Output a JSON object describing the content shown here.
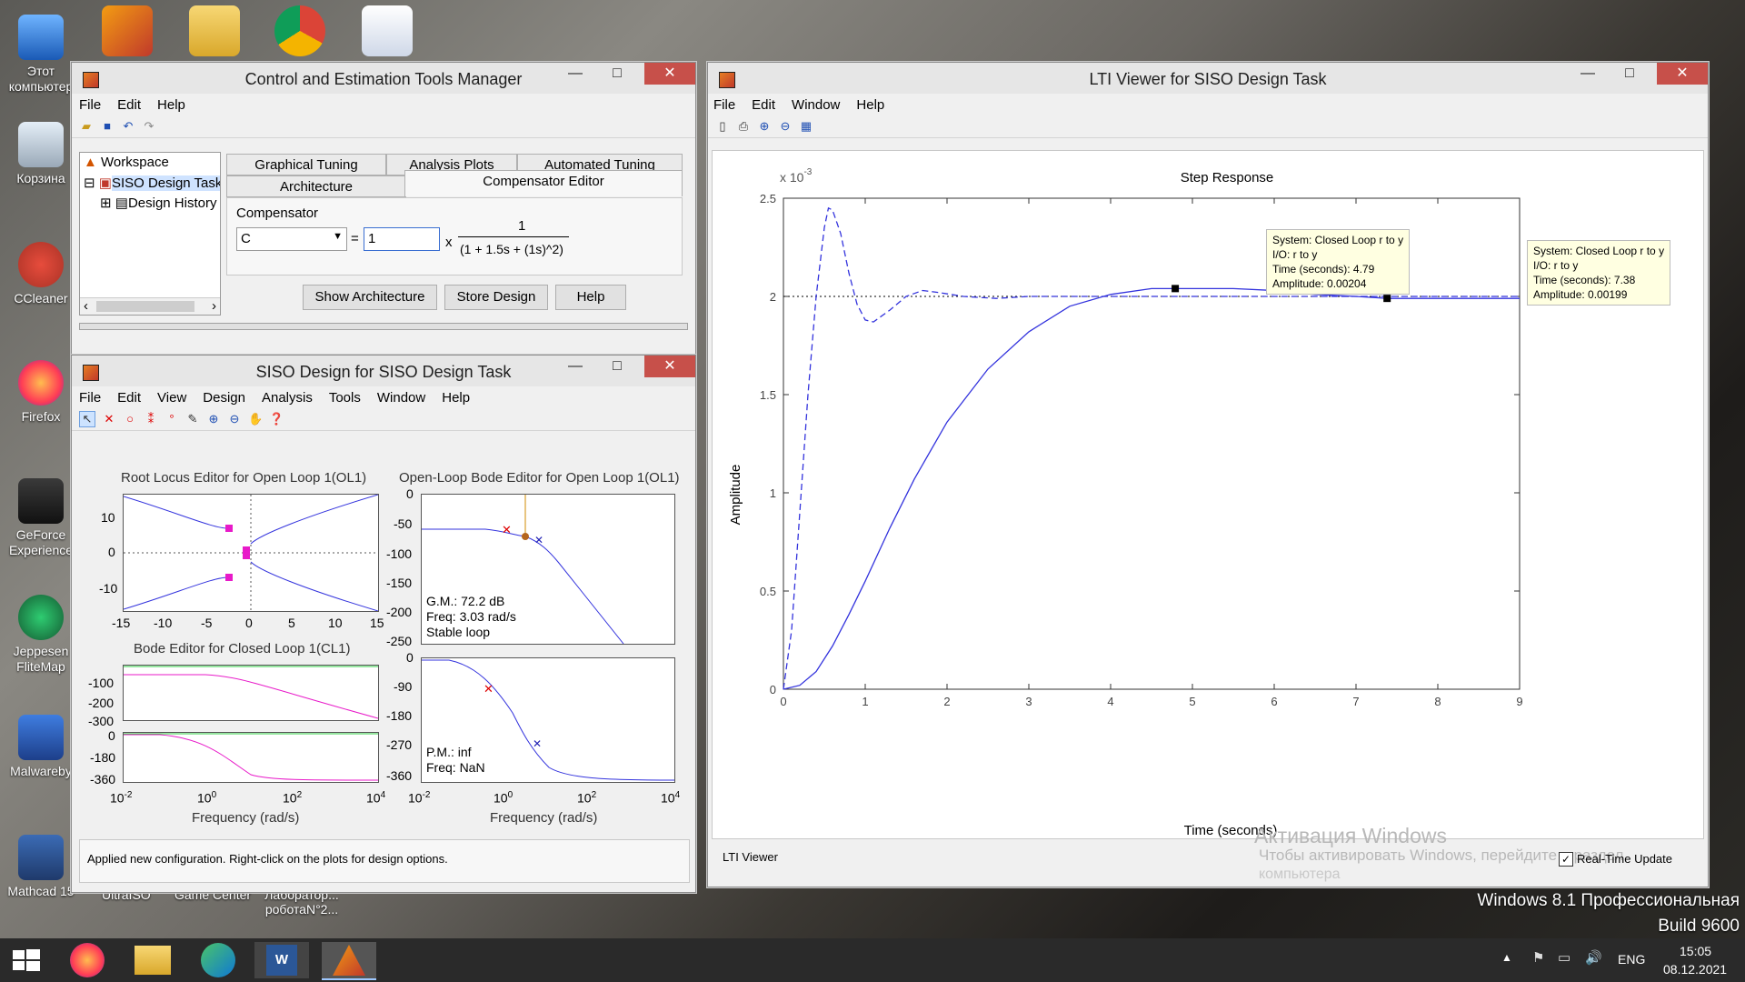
{
  "desktop": {
    "icons": [
      {
        "label": "Этот компьютер"
      },
      {
        "label": "Корзина"
      },
      {
        "label": "CCleaner"
      },
      {
        "label": "Firefox"
      },
      {
        "label": "GeForce Experience"
      },
      {
        "label": "Jeppesen FliteMap"
      },
      {
        "label": "Malwareby"
      },
      {
        "label": "Mathcad 15"
      }
    ],
    "bottom_labels": [
      "UltraISO",
      "Game Center",
      "Лаборатор... роботаN°2..."
    ],
    "watermark_title": "Активация Windows",
    "watermark_sub": "Чтобы активировать Windows, перейдите в раздел",
    "watermark_sub2": "компьютера",
    "os_name": "Windows 8.1 Профессиональная",
    "os_build": "Build 9600"
  },
  "ctm": {
    "title": "Control and Estimation Tools Manager",
    "menu": [
      "File",
      "Edit",
      "Help"
    ],
    "tree": {
      "root": "Workspace",
      "child": "SISO Design Task",
      "grandchild": "Design History"
    },
    "tabs_row1": [
      "Graphical Tuning",
      "Analysis Plots",
      "Automated Tuning"
    ],
    "tabs_row2": [
      "Architecture",
      "Compensator Editor"
    ],
    "compensator_label": "Compensator",
    "comp_select": "C",
    "equals": "=",
    "gain_value": "1",
    "times": "x",
    "numerator": "1",
    "denominator": "(1 + 1.5s + (1s)^2)",
    "buttons": [
      "Show Architecture",
      "Store Design",
      "Help"
    ]
  },
  "siso": {
    "title": "SISO Design for SISO Design Task",
    "menu": [
      "File",
      "Edit",
      "View",
      "Design",
      "Analysis",
      "Tools",
      "Window",
      "Help"
    ],
    "rl_title": "Root Locus Editor for Open Loop 1(OL1)",
    "olb_title": "Open-Loop Bode Editor for Open Loop 1(OL1)",
    "clb_title": "Bode Editor for Closed Loop 1(CL1)",
    "rl_yticks": [
      "10",
      "0",
      "-10"
    ],
    "rl_xticks": [
      "-15",
      "-10",
      "-5",
      "0",
      "5",
      "10",
      "15"
    ],
    "olb_mag_ticks": [
      "0",
      "-50",
      "-100",
      "-150",
      "-200",
      "-250"
    ],
    "olb_phase_ticks": [
      "0",
      "-90",
      "-180",
      "-270",
      "-360"
    ],
    "clb_mag_ticks": [
      "-100",
      "-200",
      "-300"
    ],
    "clb_phase_ticks": [
      "0",
      "-180",
      "-360"
    ],
    "gm_text": [
      "G.M.: 72.2 dB",
      "Freq: 3.03 rad/s",
      "Stable loop"
    ],
    "pm_text": [
      "P.M.: inf",
      "Freq: NaN"
    ],
    "freq_label": "Frequency (rad/s)",
    "freq_ticks": [
      {
        "base": "10",
        "exp": "-2"
      },
      {
        "base": "10",
        "exp": "0"
      },
      {
        "base": "10",
        "exp": "2"
      },
      {
        "base": "10",
        "exp": "4"
      }
    ],
    "status": "Applied new configuration. Right-click on the plots for design options."
  },
  "lti": {
    "title": "LTI Viewer for SISO Design Task",
    "menu": [
      "File",
      "Edit",
      "Window",
      "Help"
    ],
    "status": "LTI Viewer",
    "realtime_label": "Real-Time Update"
  },
  "chart_data": {
    "type": "line",
    "title": "Step Response",
    "xlabel": "Time (seconds)",
    "ylabel": "Amplitude",
    "y_multiplier": "x 10",
    "y_multiplier_exp": "-3",
    "xlim": [
      0,
      9
    ],
    "ylim": [
      0,
      0.0025
    ],
    "xticks": [
      "0",
      "1",
      "2",
      "3",
      "4",
      "5",
      "6",
      "7",
      "8",
      "9"
    ],
    "yticks": [
      "0",
      "0.5",
      "1",
      "1.5",
      "2",
      "2.5"
    ],
    "steady_state": 0.002,
    "series": [
      {
        "style": "solid",
        "x": [
          0,
          0.2,
          0.4,
          0.6,
          0.8,
          1.0,
          1.3,
          1.6,
          2.0,
          2.5,
          3.0,
          3.5,
          4.0,
          4.5,
          4.79,
          5.5,
          6.0,
          6.5,
          7.0,
          7.38,
          8.0,
          9.0
        ],
        "y": [
          0,
          2e-05,
          9e-05,
          0.00022,
          0.00038,
          0.00055,
          0.00082,
          0.00107,
          0.00136,
          0.00163,
          0.00182,
          0.00195,
          0.00201,
          0.00204,
          0.00204,
          0.00204,
          0.00203,
          0.00201,
          0.002,
          0.00199,
          0.00199,
          0.00199
        ]
      },
      {
        "style": "dashed",
        "x": [
          0,
          0.1,
          0.2,
          0.3,
          0.4,
          0.5,
          0.55,
          0.6,
          0.7,
          0.8,
          0.9,
          1.0,
          1.1,
          1.3,
          1.5,
          1.7,
          1.9,
          2.2,
          2.6,
          3.0,
          4.0,
          5.0,
          6.0,
          7.0,
          8.0,
          9.0
        ],
        "y": [
          0,
          0.0003,
          0.0009,
          0.0015,
          0.002,
          0.00235,
          0.00245,
          0.00244,
          0.00232,
          0.00212,
          0.00196,
          0.00188,
          0.00187,
          0.00193,
          0.002,
          0.00203,
          0.00202,
          0.002,
          0.00199,
          0.002,
          0.002,
          0.002,
          0.002,
          0.002,
          0.002,
          0.002
        ]
      }
    ],
    "datatips": [
      {
        "lines": [
          "System: Closed Loop r to y",
          "I/O: r to y",
          "Time (seconds): 4.79",
          "Amplitude: 0.00204"
        ],
        "x": 4.79,
        "y": 0.00204
      },
      {
        "lines": [
          "System: Closed Loop r to y",
          "I/O: r to y",
          "Time (seconds): 7.38",
          "Amplitude: 0.00199"
        ],
        "x": 7.38,
        "y": 0.00199
      }
    ]
  },
  "taskbar": {
    "lang": "ENG",
    "time": "15:05",
    "date": "08.12.2021"
  },
  "colors": {
    "line": "#3333dd",
    "pink": "#e81ac9",
    "close": "#c7504a"
  }
}
